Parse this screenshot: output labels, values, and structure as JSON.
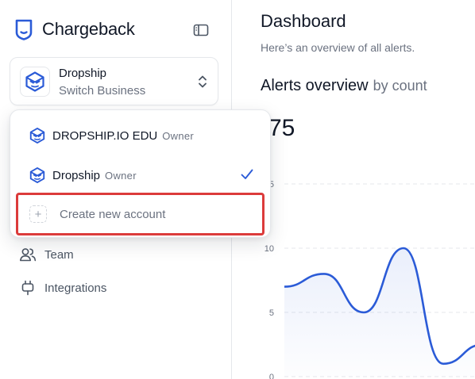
{
  "brand": {
    "name": "Chargeback",
    "logo_icon": "shield-icon"
  },
  "switcher": {
    "name": "Dropship",
    "subtitle": "Switch Business"
  },
  "nav": [
    {
      "label": "Team",
      "icon": "team-icon"
    },
    {
      "label": "Integrations",
      "icon": "plug-icon"
    }
  ],
  "dropdown": {
    "accounts": [
      {
        "name": "DROPSHIP.IO EDU",
        "role": "Owner",
        "selected": false
      },
      {
        "name": "Dropship",
        "role": "Owner",
        "selected": true
      }
    ],
    "create_label": "Create new account"
  },
  "main": {
    "title": "Dashboard",
    "subtitle": "Here’s an overview of all alerts.",
    "alerts_title": "Alerts overview",
    "alerts_qualifier": "by count",
    "total": "75"
  },
  "chart_data": {
    "type": "area",
    "y_ticks": [
      "5",
      "10",
      "5",
      "0"
    ],
    "ylim": [
      0,
      15
    ],
    "series": [
      {
        "values": [
          7.0,
          8.0,
          5.0,
          10.0,
          1.0,
          2.5
        ]
      }
    ],
    "grid": true
  },
  "colors": {
    "accent": "#2b5bd7",
    "highlight": "#dc3b3b",
    "check": "#2b5bd7"
  }
}
